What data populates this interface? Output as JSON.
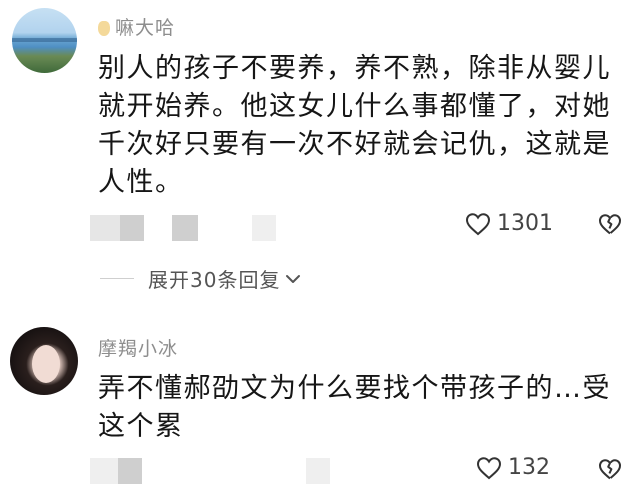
{
  "comments": [
    {
      "username": "嘛大哈",
      "text": "别人的孩子不要养，养不熟，除非从婴儿\n就开始养。他这女儿什么事都懂了，对她\n千次好只要有一次不好就会记仇，这就是\n人性。",
      "likes": "1301",
      "expand_replies_label": "展开30条回复"
    },
    {
      "username": "摩羯小冰",
      "text": "弄不懂郝劭文为什么要找个带孩子的…受\n这个累",
      "likes": "132"
    }
  ],
  "icons": {
    "like": "heart-outline-icon",
    "dislike": "broken-heart-icon",
    "expand": "chevron-down-icon"
  },
  "colors": {
    "text": "#161616",
    "meta": "#8e8e8e",
    "icon": "#333333"
  }
}
